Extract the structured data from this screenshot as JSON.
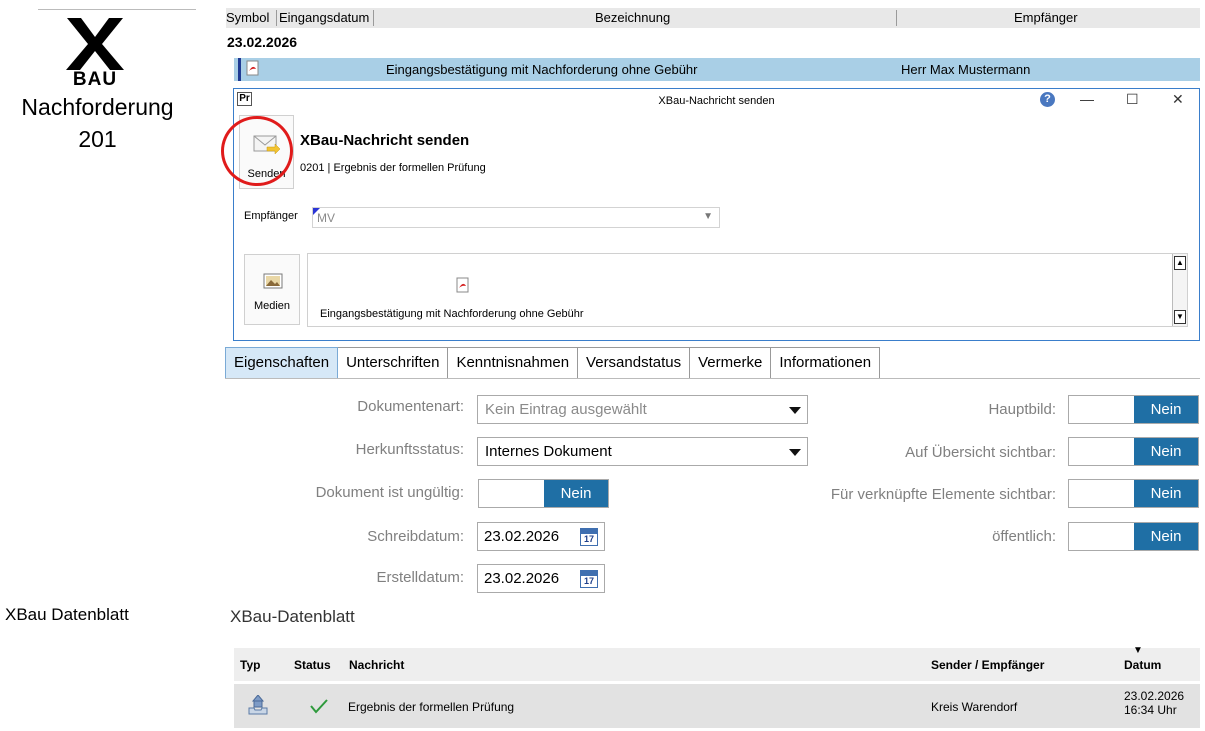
{
  "brand": {
    "letter": "X",
    "sub": "BAU",
    "title": "Nachforderung",
    "number": "201"
  },
  "side": {
    "datenblatt_label": "XBau Datenblatt"
  },
  "doclist": {
    "headers": {
      "symbol": "Symbol",
      "eingangsdatum": "Eingangsdatum",
      "bezeichnung": "Bezeichnung",
      "empfaenger": "Empfänger"
    },
    "date_group": "23.02.2026",
    "row": {
      "bezeichnung": "Eingangsbestätigung mit Nachforderung ohne Gebühr",
      "empfaenger": "Herr Max Mustermann"
    }
  },
  "dialog": {
    "app_icon": "Pr",
    "title": "XBau-Nachricht senden",
    "controls": {
      "minimize": "—",
      "maximize": "☐",
      "close": "✕"
    },
    "send_label": "Senden",
    "heading": "XBau-Nachricht senden",
    "subheading": "0201 | Ergebnis der formellen Prüfung",
    "recipient_label": "Empfänger",
    "recipient_value": "MV",
    "media_label": "Medien",
    "media_caption": "Eingangsbestätigung mit Nachforderung ohne Gebühr"
  },
  "tabs": [
    "Eigenschaften",
    "Unterschriften",
    "Kenntnisnahmen",
    "Versandstatus",
    "Vermerke",
    "Informationen"
  ],
  "props": {
    "dokumentenart": {
      "label": "Dokumentenart:",
      "value": "Kein Eintrag ausgewählt"
    },
    "herkunftsstatus": {
      "label": "Herkunftsstatus:",
      "value": "Internes Dokument"
    },
    "ungueltig": {
      "label": "Dokument ist ungültig:",
      "value": "Nein"
    },
    "schreibdatum": {
      "label": "Schreibdatum:",
      "value": "23.02.2026"
    },
    "erstelldatum": {
      "label": "Erstelldatum:",
      "value": "23.02.2026"
    },
    "hauptbild": {
      "label": "Hauptbild:",
      "value": "Nein"
    },
    "uebersicht": {
      "label": "Auf Übersicht sichtbar:",
      "value": "Nein"
    },
    "verknuepft": {
      "label": "Für verknüpfte Elemente sichtbar:",
      "value": "Nein"
    },
    "oeffentlich": {
      "label": "öffentlich:",
      "value": "Nein"
    },
    "calendar_day": "17"
  },
  "datenblatt": {
    "title": "XBau-Datenblatt",
    "columns": {
      "typ": "Typ",
      "status": "Status",
      "nachricht": "Nachricht",
      "sender": "Sender / Empfänger",
      "datum": "Datum"
    },
    "sort_indicator": "▼",
    "row": {
      "status_icon": "check-icon",
      "nachricht": "Ergebnis der formellen Prüfung",
      "sender": "Kreis Warendorf",
      "date": "23.02.2026",
      "time": "16:34 Uhr"
    }
  },
  "colors": {
    "accent": "#1f6fa5",
    "selection": "#a9cfe6",
    "highlight": "#e01b1b"
  }
}
